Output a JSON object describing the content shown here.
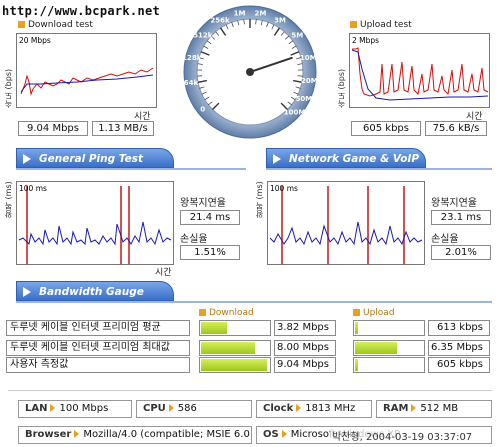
{
  "watermark": "http://www.bcpark.net",
  "download_test": {
    "title": "Download test",
    "yaxis_label": "속도 (bps)",
    "top_tick": "20 Mbps",
    "xaxis_label": "시간",
    "speed_mbps": "9.04 Mbps",
    "speed_mbs": "1.13 MB/s"
  },
  "upload_test": {
    "title": "Upload test",
    "yaxis_label": "속도 (bps)",
    "top_tick": "2 Mbps",
    "xaxis_label": "시간",
    "speed_kbps": "605 kbps",
    "speed_kbs": "75.6 kB/s"
  },
  "gauge": {
    "labels": [
      "1M",
      "2M",
      "3M",
      "5M",
      "10M",
      "20M",
      "50M",
      "100M",
      "256k",
      "512k",
      "128k",
      "64k",
      "0"
    ],
    "needle_value_mbps": 9.04
  },
  "tabs": {
    "general_ping": "General Ping Test",
    "network_game": "Network Game & VoIP Test",
    "bandwidth": "Bandwidth Gauge"
  },
  "ping_general": {
    "yaxis_label": "왕복 (ms)",
    "top_tick": "100 ms",
    "xaxis_label": "시간",
    "rtt_label": "왕복지연율",
    "rtt_value": "21.4 ms",
    "loss_label": "손실율",
    "loss_value": "1.51%"
  },
  "ping_game": {
    "yaxis_label": "왕복 (ms)",
    "top_tick": "100 ms",
    "rtt_label": "왕복지연율",
    "rtt_value": "23.1 ms",
    "loss_label": "손실율",
    "loss_value": "2.01%"
  },
  "bandwidth": {
    "download_header": "Download",
    "upload_header": "Upload",
    "rows": [
      {
        "label": "두루넷 케이블 인터넷 프리미엄 평균",
        "download": "3.82 Mbps",
        "download_fraction": 0.38,
        "upload": "613 kbps",
        "upload_fraction": 0.05
      },
      {
        "label": "두루넷 케이블 인터넷 프리미엄 최대값",
        "download": "8.00 Mbps",
        "download_fraction": 0.8,
        "upload": "6.35 Mbps",
        "upload_fraction": 0.62
      },
      {
        "label": "사용자 측정값",
        "download": "9.04 Mbps",
        "download_fraction": 0.97,
        "upload": "605 kbps",
        "upload_fraction": 0.05
      }
    ]
  },
  "system_info": {
    "lan_key": "LAN",
    "lan_value": "100 Mbps",
    "cpu_key": "CPU",
    "cpu_value": "586",
    "clock_key": "Clock",
    "clock_value": "1813 MHz",
    "ram_key": "RAM",
    "ram_value": "512 MB",
    "browser_key": "Browser",
    "browser_value": "Mozilla/4.0 (compatible; MSIE 6.0",
    "os_key": "OS",
    "os_value": "Microsoft Windows XP",
    "timestamp": "박찬형, 2004-03-19 03:37:07"
  },
  "colors": {
    "download_line": "#cc1010",
    "avg_line": "#1a1aa0",
    "ping_line": "#1a1ab0",
    "spike": "#c01818",
    "bar_fill": "#a8d42a",
    "tab_blue": "#3a6fc8",
    "bullet_orange": "#e8a020"
  }
}
